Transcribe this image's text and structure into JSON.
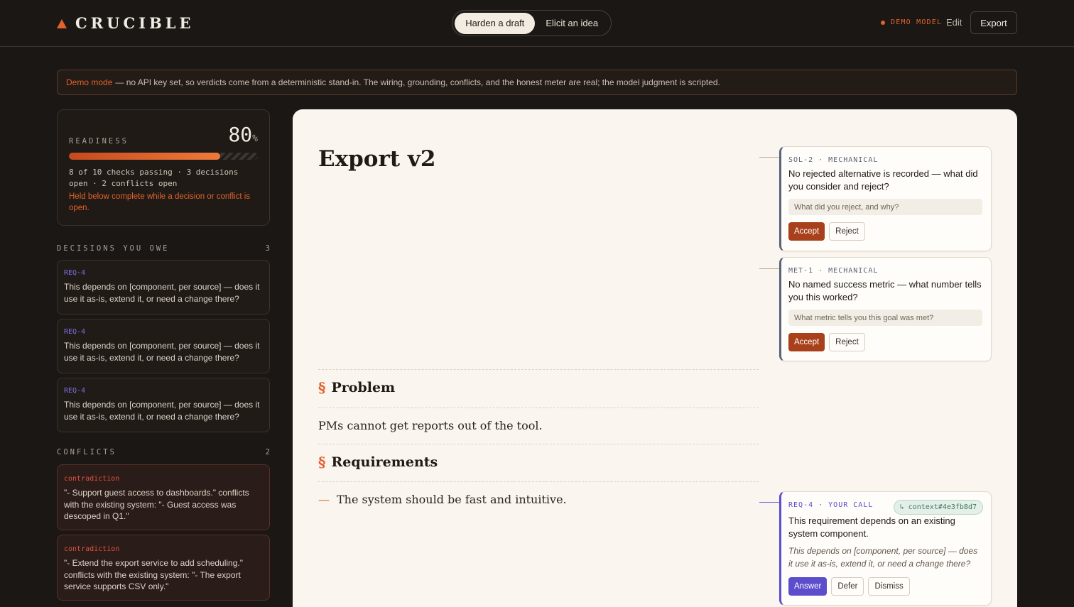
{
  "header": {
    "brand": "CRUCIBLE",
    "modes": [
      "Harden a draft",
      "Elicit an idea"
    ],
    "demo_badge": "DEMO MODEL",
    "edit_label": "Edit",
    "export_label": "Export"
  },
  "banner": {
    "highlight": "Demo mode",
    "text": "— no API key set, so verdicts come from a deterministic stand-in. The wiring, grounding, conflicts, and the honest meter are real; the model judgment is scripted."
  },
  "readiness": {
    "label": "READINESS",
    "value": "80",
    "unit": "%",
    "progress": 0.8,
    "stats": "8 of 10 checks passing · 3 decisions open · 2 conflicts open",
    "warning": "Held below complete while a decision or conflict is open."
  },
  "decisions": {
    "heading": "DECISIONS YOU OWE",
    "count": "3",
    "items": [
      {
        "tag": "REQ-4",
        "text": "This depends on [component, per source] — does it use it as-is, extend it, or need a change there?"
      },
      {
        "tag": "REQ-4",
        "text": "This depends on [component, per source] — does it use it as-is, extend it, or need a change there?"
      },
      {
        "tag": "REQ-4",
        "text": "This depends on [component, per source] — does it use it as-is, extend it, or need a change there?"
      }
    ]
  },
  "conflicts": {
    "heading": "CONFLICTS",
    "count": "2",
    "items": [
      {
        "tag": "contradiction",
        "text": "\"- Support guest access to dashboards.\" conflicts with the existing system: \"- Guest access was descoped in Q1.\""
      },
      {
        "tag": "contradiction",
        "text": "\"- Extend the export service to add scheduling.\" conflicts with the existing system: \"- The export service supports CSV only.\""
      }
    ]
  },
  "document": {
    "title": "Export v2",
    "sections": [
      {
        "symbol": "§",
        "title": "Problem",
        "body": "PMs cannot get reports out of the tool."
      },
      {
        "symbol": "§",
        "title": "Requirements",
        "items": [
          {
            "bullet": "—",
            "text": "The system should be fast and intuitive."
          }
        ]
      }
    ]
  },
  "findings": [
    {
      "tag": "SOL-2 · MECHANICAL",
      "question": "No rejected alternative is recorded — what did you consider and reject?",
      "placeholder": "What did you reject, and why?",
      "accept": "Accept",
      "reject": "Reject"
    },
    {
      "tag": "MET-1 · MECHANICAL",
      "question": "No named success metric — what number tells you this worked?",
      "placeholder": "What metric tells you this goal was met?",
      "accept": "Accept",
      "reject": "Reject"
    },
    {
      "tag": "REQ-4 · YOUR CALL",
      "context": "↳ context#4e3fb8d7",
      "question": "This requirement depends on an existing system component.",
      "note": "This depends on [component, per source] — does it use it as-is, extend it, or need a change there?",
      "answer": "Answer",
      "defer": "Defer",
      "dismiss": "Dismiss"
    }
  ]
}
